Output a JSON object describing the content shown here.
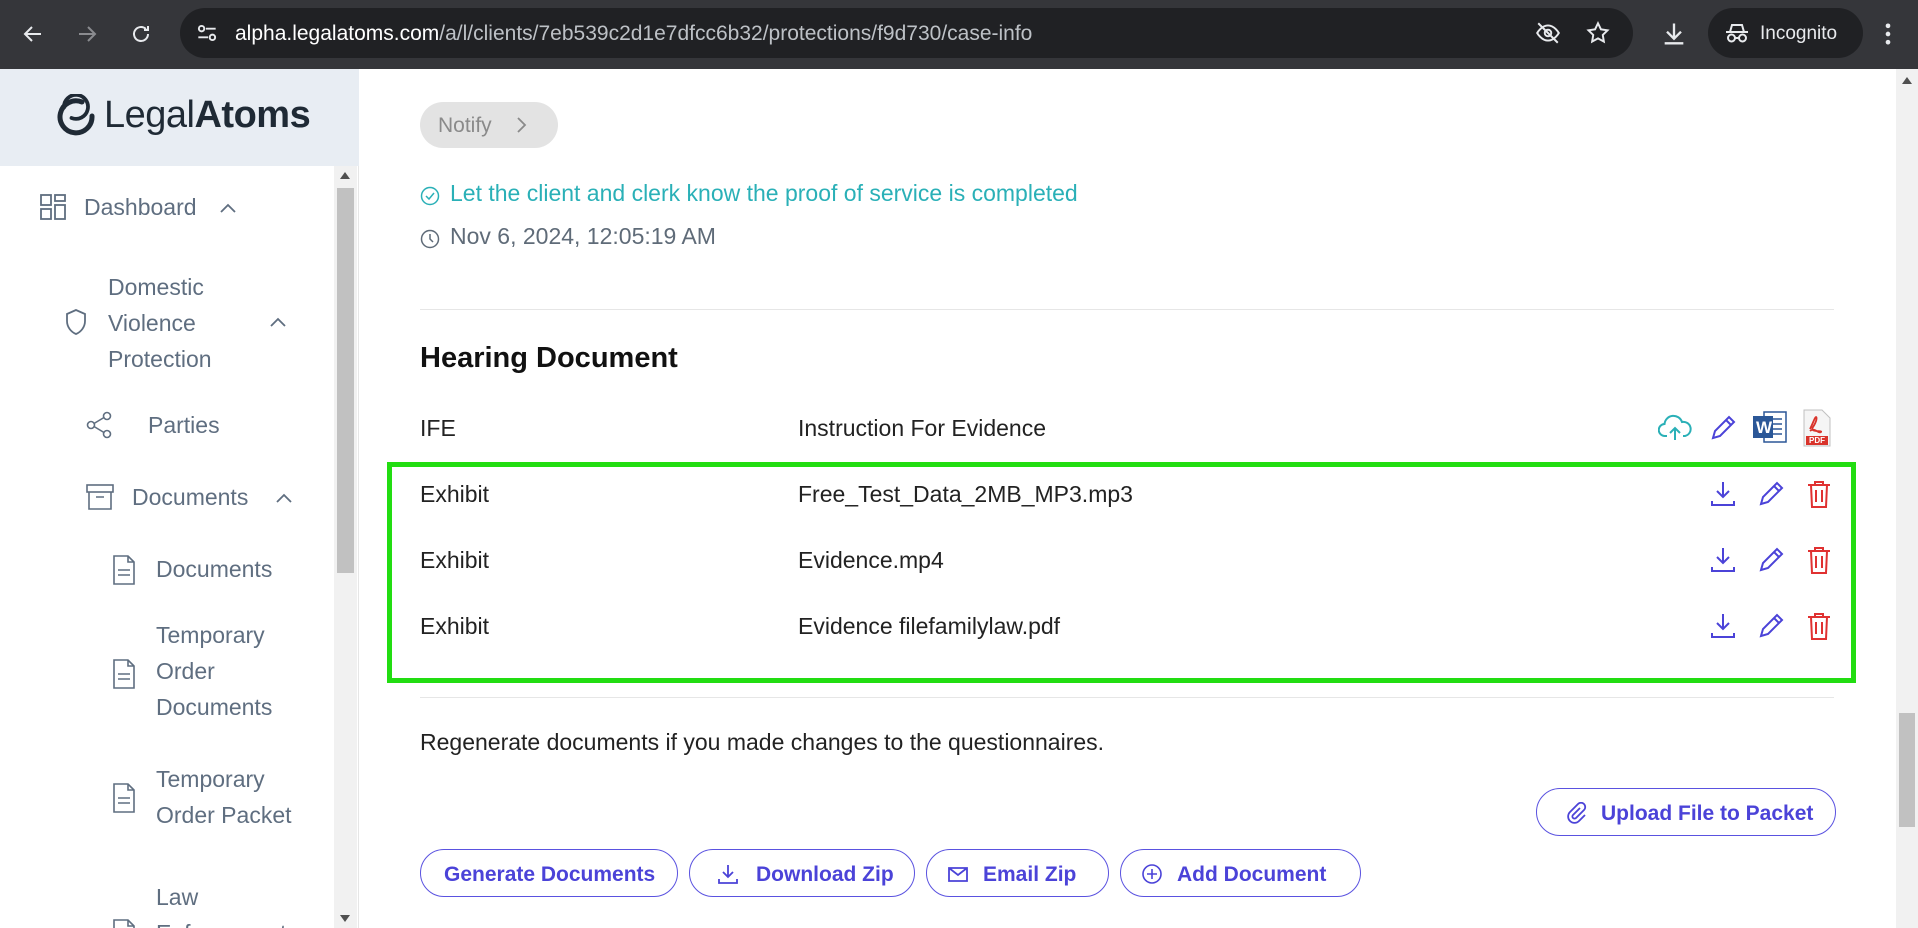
{
  "browser": {
    "url_domain": "alpha.legalatoms.com",
    "url_path": "/a/l/clients/7eb539c2d1e7dfcc6b32/protections/f9d730/case-info",
    "incognito_label": "Incognito"
  },
  "sidebar": {
    "logo_prefix": "Legal",
    "logo_suffix": "Atoms",
    "items": [
      {
        "label": "Dashboard",
        "icon": "grid-icon"
      },
      {
        "label_lines": [
          "Domestic",
          "Violence",
          "Protection"
        ],
        "icon": "shield-icon"
      },
      {
        "label": "Parties",
        "icon": "share-icon"
      },
      {
        "label": "Documents",
        "icon": "archive-icon"
      },
      {
        "label": "Documents",
        "icon": "file-icon"
      },
      {
        "label_lines": [
          "Temporary",
          "Order",
          "Documents"
        ],
        "icon": "file-icon"
      },
      {
        "label_lines": [
          "Temporary",
          "Order Packet"
        ],
        "icon": "file-icon"
      },
      {
        "label_lines": [
          "Law",
          "Enforcement"
        ],
        "icon": "file-icon"
      }
    ]
  },
  "main": {
    "notify_label": "Notify",
    "notify_message": "Let the client and clerk know the proof of service is completed",
    "notify_timestamp": "Nov 6, 2024, 12:05:19 AM",
    "section_title": "Hearing Document",
    "documents": [
      {
        "type": "IFE",
        "name": "Instruction For Evidence",
        "actions": [
          "cloud-upload-icon",
          "pencil-icon",
          "word-icon",
          "pdf-icon"
        ]
      },
      {
        "type": "Exhibit",
        "name": "Free_Test_Data_2MB_MP3.mp3",
        "actions": [
          "download-icon",
          "pencil-icon",
          "trash-icon"
        ]
      },
      {
        "type": "Exhibit",
        "name": "Evidence.mp4",
        "actions": [
          "download-icon",
          "pencil-icon",
          "trash-icon"
        ]
      },
      {
        "type": "Exhibit",
        "name": "Evidence filefamilylaw.pdf",
        "actions": [
          "download-icon",
          "pencil-icon",
          "trash-icon"
        ]
      }
    ],
    "pdf_badge": "PDF",
    "word_badge": "W",
    "regen_note": "Regenerate documents if you made changes to the questionnaires.",
    "upload_label": "Upload File to Packet",
    "generate_label": "Generate Documents",
    "download_zip_label": "Download Zip",
    "email_zip_label": "Email Zip",
    "add_document_label": "Add Document"
  },
  "colors": {
    "accent": "#4b43d8",
    "teal": "#2ab0b7",
    "danger": "#e03131",
    "highlight": "#22dd11",
    "chrome_bg": "#35363a"
  }
}
